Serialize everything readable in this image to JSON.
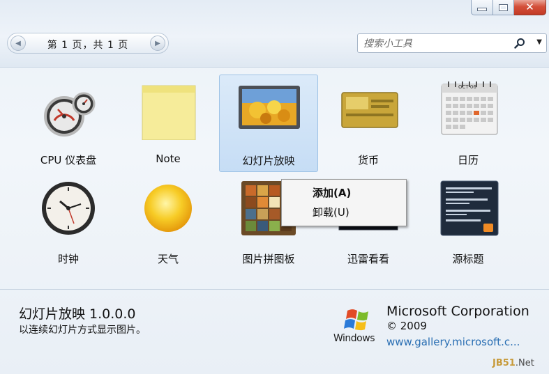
{
  "toolbar": {
    "pager_text": "第 1 页，共 1 页",
    "search_placeholder": "搜索小工具"
  },
  "gadgets": [
    {
      "label": "CPU 仪表盘",
      "icon": "cpu-meter-icon"
    },
    {
      "label": "Note",
      "icon": "sticky-note-icon"
    },
    {
      "label": "幻灯片放映",
      "icon": "slideshow-icon",
      "selected": true
    },
    {
      "label": "货币",
      "icon": "currency-icon"
    },
    {
      "label": "日历",
      "icon": "calendar-icon"
    },
    {
      "label": "时钟",
      "icon": "clock-icon"
    },
    {
      "label": "天气",
      "icon": "weather-icon"
    },
    {
      "label": "图片拼图板",
      "icon": "picture-puzzle-icon"
    },
    {
      "label": "迅雷看看",
      "icon": "xunlei-kankan-icon"
    },
    {
      "label": "源标题",
      "icon": "feed-headlines-icon"
    }
  ],
  "context_menu": {
    "items": [
      "添加(A)",
      "卸载(U)"
    ]
  },
  "calendar_icon": {
    "month": "OCT 06"
  },
  "details": {
    "title": "幻灯片放映 1.0.0.0",
    "description": "以连续幻灯片方式显示图片。",
    "publisher": "Microsoft Corporation",
    "copyright": "© 2009",
    "link": "www.gallery.microsoft.c...",
    "logo_text": "Windows"
  },
  "watermark": {
    "brand": "JB51",
    "suffix": ".Net"
  },
  "colors": {
    "accent": "#2a6fb3",
    "selection": "#c6ddf5",
    "close": "#c23a25"
  }
}
